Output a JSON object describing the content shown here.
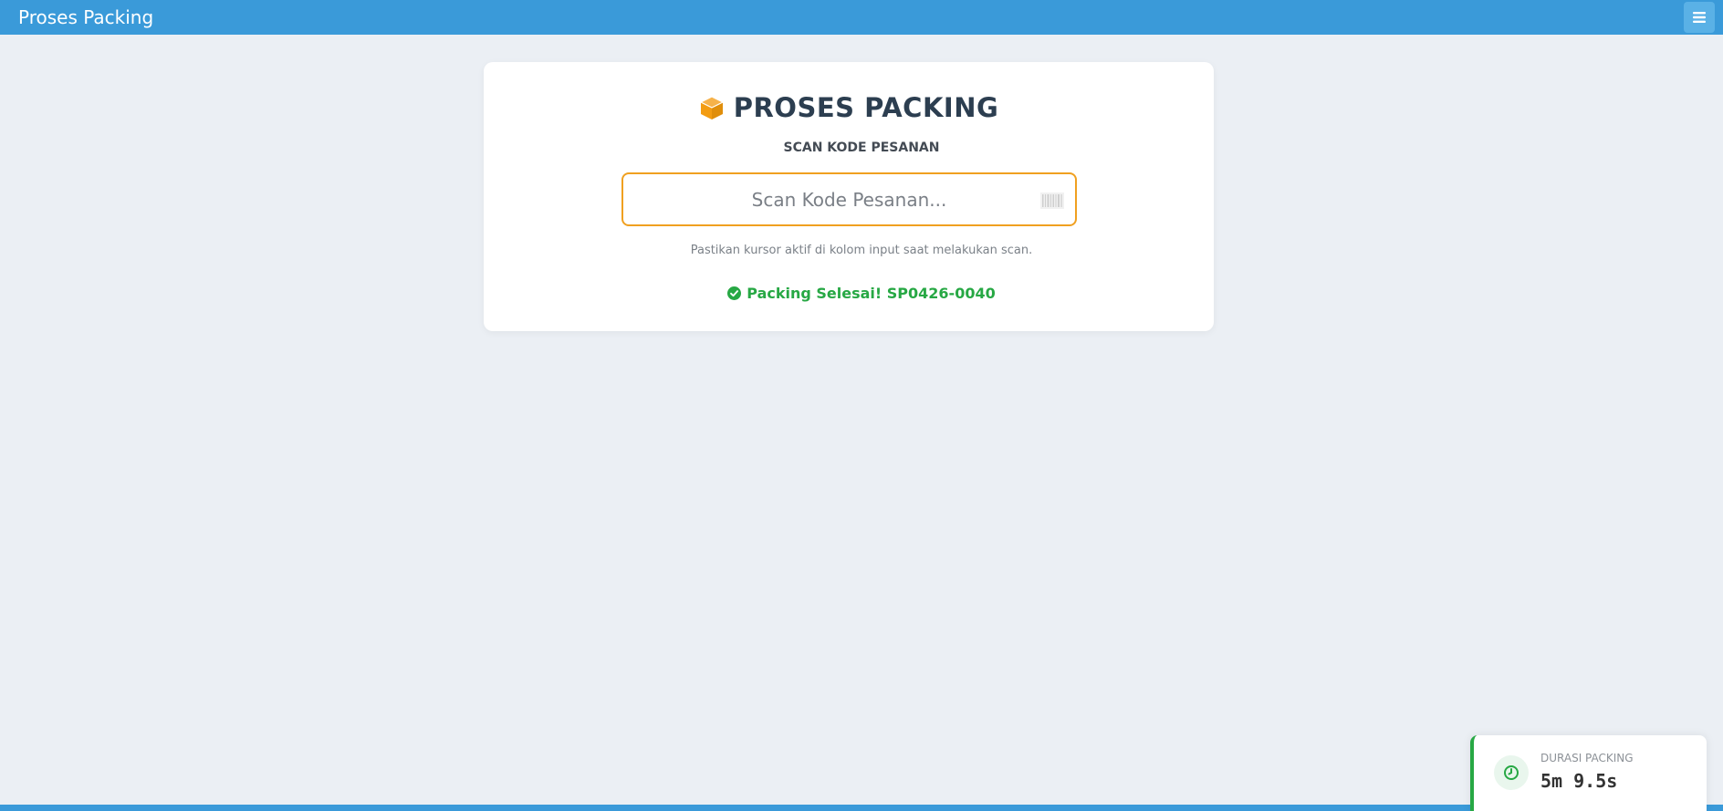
{
  "header": {
    "title": "Proses Packing",
    "menu_icon": "hamburger-menu-icon"
  },
  "card": {
    "icon": "box-icon",
    "title": "PROSES PACKING",
    "field_label": "SCAN KODE PESANAN",
    "input": {
      "placeholder": "Scan Kode Pesanan...",
      "value": ""
    },
    "input_icon": "barcode-icon",
    "hint": "Pastikan kursor aktif di kolom input saat melakukan scan.",
    "status": {
      "icon": "check-circle-icon",
      "text": "Packing Selesai! SP0426-0040"
    }
  },
  "duration": {
    "icon": "clock-icon",
    "label": "DURASI PACKING",
    "value": "5m 9.5s"
  },
  "colors": {
    "header": "#3a9ad9",
    "accent": "#f0a020",
    "success": "#27a844",
    "title": "#2c3e50",
    "background": "#ebeff4"
  }
}
